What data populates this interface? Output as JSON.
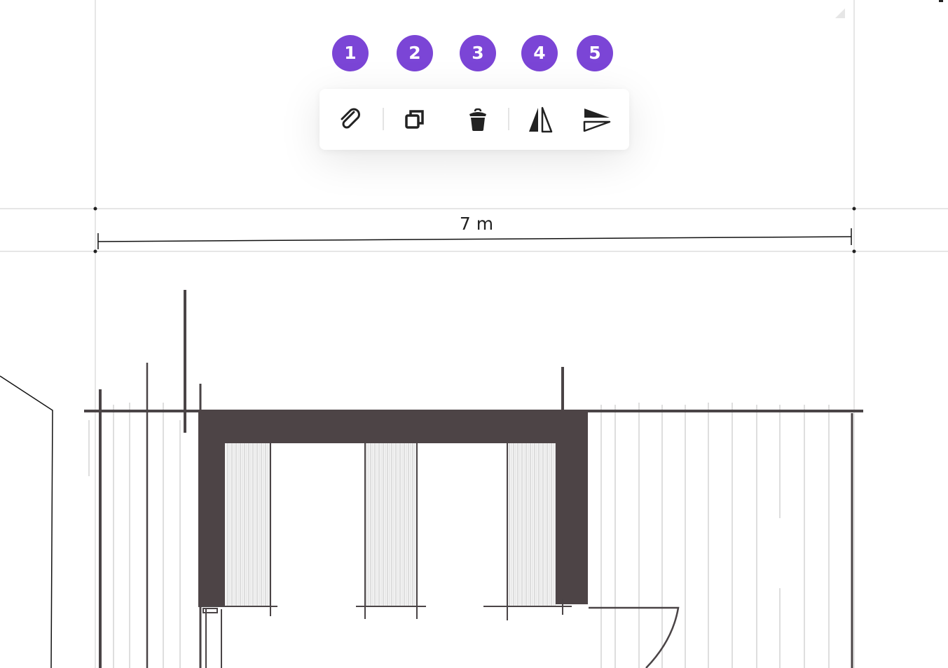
{
  "badges": [
    "1",
    "2",
    "3",
    "4",
    "5"
  ],
  "toolbar": {
    "tools": [
      {
        "name": "attach",
        "icon": "paperclip-icon"
      },
      {
        "name": "duplicate",
        "icon": "duplicate-icon"
      },
      {
        "name": "delete",
        "icon": "trash-icon"
      },
      {
        "name": "flip-horizontal",
        "icon": "flip-horizontal-icon"
      },
      {
        "name": "flip-vertical",
        "icon": "flip-vertical-icon"
      }
    ]
  },
  "dimension": {
    "label": "7 m"
  },
  "colors": {
    "accent": "#7b45d6",
    "wall": "#4d4446",
    "guide": "#dddddd",
    "icon": "#222222"
  }
}
